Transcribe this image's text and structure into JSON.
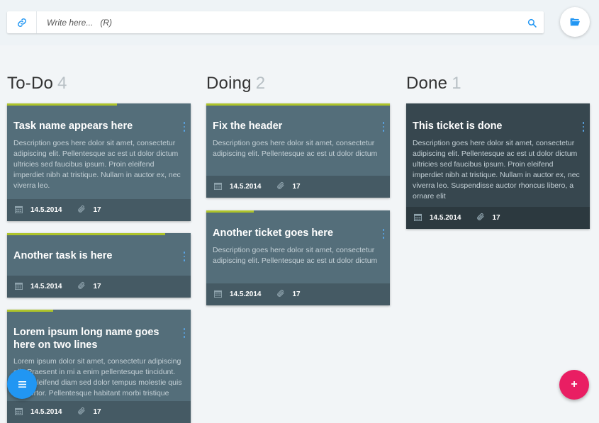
{
  "search": {
    "placeholder": "Write here...   (R)",
    "value": ""
  },
  "icons": {
    "link": "link-icon",
    "search": "search-icon",
    "folder": "folder-open-icon",
    "menu": "hamburger-menu-icon",
    "add": "plus-icon",
    "calendar": "calendar-icon",
    "attachment": "paperclip-icon",
    "card_menu": "more-vertical-icon"
  },
  "colors": {
    "accent_blue": "#2196f3",
    "add_pink": "#e91e63",
    "progress_green": "#aec42a",
    "card": "#546e7a",
    "card_done": "#37474f"
  },
  "columns": [
    {
      "title": "To-Do",
      "count": "4",
      "cards": [
        {
          "title": "Task name appears here",
          "description": "Description goes here dolor sit amet, consectetur adipiscing elit. Pellentesque ac est ut dolor dictum ultricies sed faucibus ipsum. Proin eleifend imperdiet nibh at tristique. Nullam in auctor ex, nec viverra leo.",
          "date": "14.5.2014",
          "attachments": "17",
          "progress": 0.6
        },
        {
          "title": "Another task is here",
          "description": "",
          "date": "14.5.2014",
          "attachments": "17",
          "progress": 0.86
        },
        {
          "title": "Lorem ipsum long name goes here on two lines",
          "description": "Lorem ipsum dolor sit amet, consectetur adipiscing elit. Praesent in mi a enim pellentesque tincidunt. Proin eleifend diam sed dolor tempus molestie quis nec tortor. Pellentesque habitant morbi tristique",
          "date": "14.5.2014",
          "attachments": "17",
          "progress": 0.25
        }
      ]
    },
    {
      "title": "Doing",
      "count": "2",
      "cards": [
        {
          "title": "Fix the header",
          "description": "Description goes here dolor sit amet, consectetur adipiscing elit. Pellentesque ac est ut dolor dictum",
          "date": "14.5.2014",
          "attachments": "17",
          "progress": 1.0
        },
        {
          "title": "Another ticket goes here",
          "description": "Description goes here dolor sit amet, consectetur adipiscing elit. Pellentesque ac est ut dolor dictum",
          "date": "14.5.2014",
          "attachments": "17",
          "progress": 0.26
        }
      ]
    },
    {
      "title": "Done",
      "count": "1",
      "cards": [
        {
          "title": "This ticket is done",
          "description": "Description goes here dolor sit amet, consectetur adipiscing elit. Pellentesque ac est ut dolor dictum ultricies sed faucibus ipsum. Proin eleifend imperdiet nibh at tristique. Nullam in auctor ex, nec viverra leo. Suspendisse auctor rhoncus libero, a ornare elit",
          "date": "14.5.2014",
          "attachments": "17",
          "progress": 0
        }
      ]
    }
  ],
  "fab": {
    "add_label": "+"
  }
}
